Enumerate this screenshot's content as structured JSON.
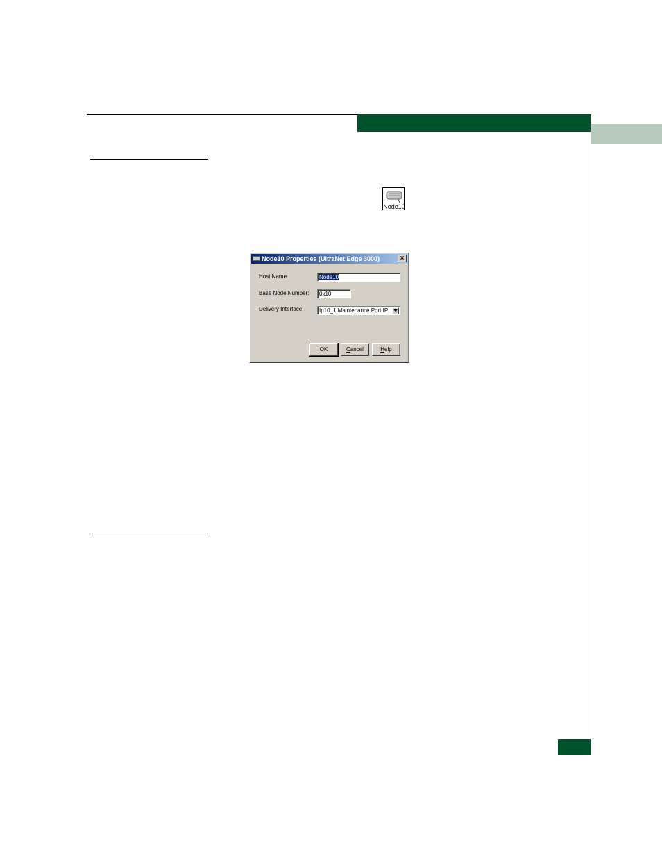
{
  "node_icon": {
    "label": "Node10",
    "icon": "node-device-icon"
  },
  "dialog": {
    "title": "Node10 Properties (UltraNet Edge 3000)",
    "close_label": "×",
    "fields": {
      "host_name": {
        "label": "Host Name:",
        "value": "Node10"
      },
      "base_node_number": {
        "label": "Base Node Number:",
        "value": "0x10"
      },
      "delivery_interface": {
        "label": "Delivery Interface",
        "value": "Ip10_1 Maintenance Port IP"
      }
    },
    "buttons": {
      "ok": "OK",
      "cancel_first": "C",
      "cancel_rest": "ancel",
      "help_first": "H",
      "help_rest": "elp"
    }
  },
  "colors": {
    "accent_green": "#00522a",
    "tab_green": "#b9cbbd",
    "dialog_face": "#d4d0c8",
    "title_blue": "#0a246a"
  }
}
